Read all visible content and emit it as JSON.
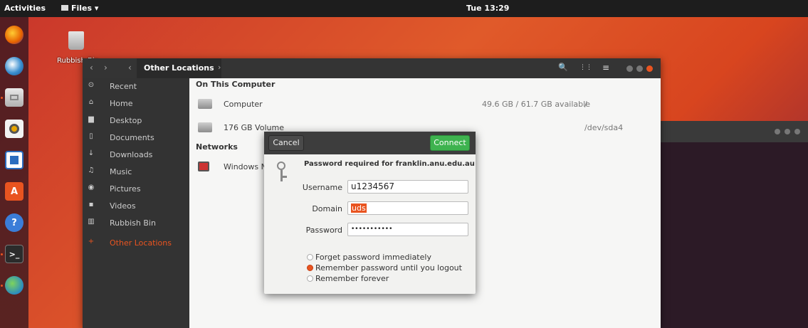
{
  "topbar": {
    "activities": "Activities",
    "app_menu": "Files ▾",
    "clock": "Tue 13:29"
  },
  "desktop": {
    "bin_label": "Rubbish Bin"
  },
  "dock": {
    "apps": [
      "firefox-icon",
      "thunderbird-icon",
      "files-icon",
      "rhythmbox-icon",
      "writer-icon",
      "software-icon",
      "help-icon",
      "terminal-icon",
      "globe-icon"
    ]
  },
  "toolbar": {
    "back": "‹",
    "forward": "›",
    "crumb_prev": "‹",
    "location": "Other Locations",
    "crumb_next": "›",
    "search": "🔍",
    "view": "⋮⋮",
    "menu": "≡"
  },
  "sidebar": {
    "items": [
      {
        "icon": "clock-icon",
        "glyph": "⊙",
        "label": "Recent"
      },
      {
        "icon": "home-icon",
        "glyph": "⌂",
        "label": "Home"
      },
      {
        "icon": "folder-icon",
        "glyph": "▆",
        "label": "Desktop"
      },
      {
        "icon": "document-icon",
        "glyph": "▯",
        "label": "Documents"
      },
      {
        "icon": "download-icon",
        "glyph": "↓",
        "label": "Downloads"
      },
      {
        "icon": "music-icon",
        "glyph": "♫",
        "label": "Music"
      },
      {
        "icon": "camera-icon",
        "glyph": "◉",
        "label": "Pictures"
      },
      {
        "icon": "video-icon",
        "glyph": "▪",
        "label": "Videos"
      },
      {
        "icon": "trash-icon",
        "glyph": "▥",
        "label": "Rubbish Bin"
      },
      {
        "icon": "plus-icon",
        "glyph": "+",
        "label": "Other Locations"
      }
    ]
  },
  "main": {
    "section_computer": "On This Computer",
    "section_networks": "Networks",
    "computer": {
      "name": "Computer",
      "info": "49.6 GB / 61.7 GB available",
      "mount": "/"
    },
    "volume": {
      "name": "176 GB Volume",
      "mount": "/dev/sda4"
    },
    "network": {
      "name": "Windows N"
    }
  },
  "dialog": {
    "cancel": "Cancel",
    "connect": "Connect",
    "title": "Password required for franklin.anu.edu.au",
    "username_label": "Username",
    "username_value": "u1234567",
    "domain_label": "Domain",
    "domain_value": "uds",
    "password_label": "Password",
    "password_value": "•••••••••••",
    "radio_forget": "Forget password immediately",
    "radio_remember": "Remember password until you logout",
    "radio_forever": "Remember forever",
    "selected_option": "Remember password until you logout"
  }
}
